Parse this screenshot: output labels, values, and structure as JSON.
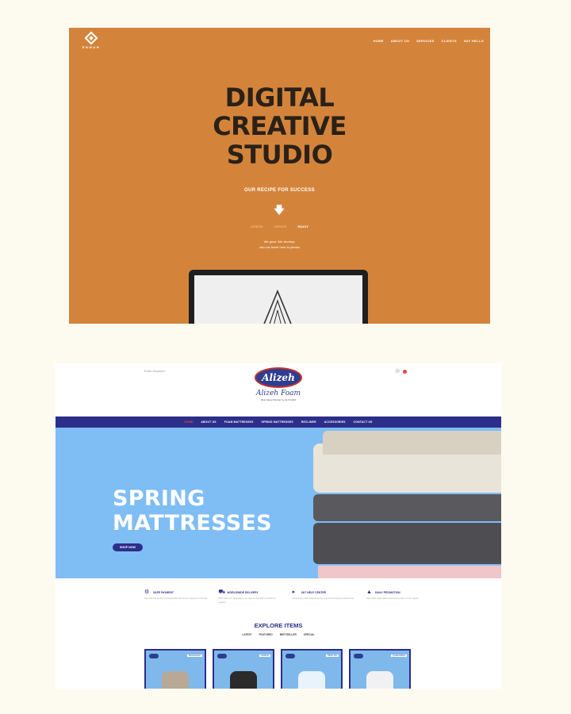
{
  "shot1": {
    "logo_word": "ENWAR",
    "nav": [
      "HOME",
      "ABOUT US",
      "SERVICES",
      "CLIENTS",
      "SAY HELLO"
    ],
    "headline": [
      "DIGITAL",
      "CREATIVE",
      "STUDIO"
    ],
    "recipe": "OUR RECIPE FOR SUCCESS",
    "arrow_icon": "arrow-down-icon",
    "tabs": [
      "DESIGN",
      "CREATE",
      "ENJOY"
    ],
    "tagline": [
      "We grow. We develop.",
      "who we tweet here to please"
    ],
    "colors": {
      "background": "#d4843a",
      "headline": "#2a2118"
    }
  },
  "shot2": {
    "search_placeholder": "Enter keyword",
    "brand_badge": "Alizeh",
    "brand_script": "Alizeh Foam",
    "brand_small": "Best Sleep Partner by ALI FOAM",
    "menu": [
      "HOME",
      "ABOUT US",
      "FOAM MATTRESSES",
      "SPRING MATTRESSES",
      "RECLINER",
      "ACCESSORIES",
      "CONTACT US"
    ],
    "hero_title": [
      "SPRING",
      "MATTRESSES"
    ],
    "shop_button": "SHOP NOW",
    "features": [
      {
        "icon": "gear-icon",
        "title": "SAFE PAYMENT",
        "desc": "Pay with the world's most popular and secure payment methods."
      },
      {
        "icon": "truck-icon",
        "title": "WORLDWIDE DELIVERY",
        "desc": "With Sites in 5 languages, we ship to over 200 countries & regions."
      },
      {
        "icon": "megaphone-icon",
        "title": "24/7 HELP CENTER",
        "desc": "Round-the-clock assistance for a smooth shopping experience."
      },
      {
        "icon": "hat-icon",
        "title": "DAILY PROMOTION",
        "desc": "New daily deals discovered every hour, on our pages."
      }
    ],
    "explore_title": "EXPLORE ITEMS",
    "filters": [
      "LATEST",
      "FEATURED",
      "BESTSELLER",
      "SPECIAL"
    ],
    "products": [
      {
        "label": "Bed Recliner",
        "item_color": "#b8a896"
      },
      {
        "label": "Recliner",
        "item_color": "#2b2b2b"
      },
      {
        "label": "Pillow Top",
        "item_color": "#e9f3fb"
      },
      {
        "label": "Quilted Pillow",
        "item_color": "#f1f1f4"
      }
    ],
    "colors": {
      "brand": "#2d2e8a",
      "hero": "#7fbdf5",
      "accent": "#e3473d"
    }
  }
}
